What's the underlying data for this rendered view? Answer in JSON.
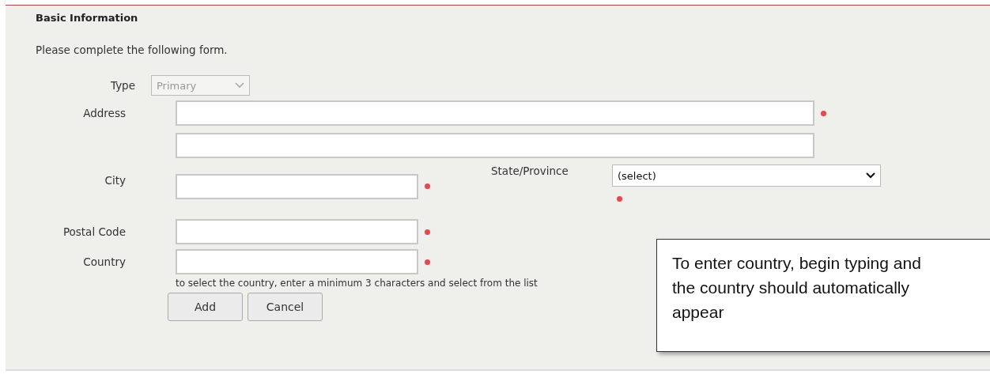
{
  "section_title": "Basic Information",
  "intro": "Please complete the following form.",
  "type_field": {
    "label": "Type",
    "value": "Primary",
    "disabled": true
  },
  "address": {
    "label": "Address",
    "required": true
  },
  "city": {
    "label": "City",
    "required": true
  },
  "state": {
    "label": "State/Province",
    "value": "(select)",
    "required": true
  },
  "postal_code": {
    "label": "Postal Code",
    "required": true
  },
  "country": {
    "label": "Country",
    "required": true,
    "hint": "to select the country, enter a minimum 3 characters and select from the list"
  },
  "buttons": [
    "Add",
    "Cancel"
  ],
  "callout": "To enter country, begin typing and the country should automatically appear"
}
